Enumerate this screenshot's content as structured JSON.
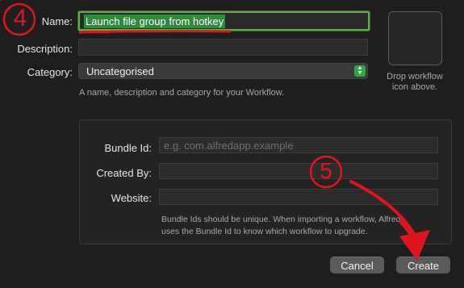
{
  "form": {
    "name_label": "Name:",
    "name_value": "Launch file group from hotkey",
    "description_label": "Description:",
    "description_value": "",
    "category_label": "Category:",
    "category_value": "Uncategorised",
    "form_hint": "A name, description and category for your Workflow.",
    "icon_drop_hint_line1": "Drop workflow",
    "icon_drop_hint_line2": "icon above."
  },
  "info": {
    "bundle_id_label": "Bundle Id:",
    "bundle_id_placeholder": "e.g. com.alfredapp.example",
    "created_by_label": "Created By:",
    "created_by_value": "",
    "website_label": "Website:",
    "website_value": "",
    "hint_line1": "Bundle Ids should be unique. When importing a workflow, Alfred",
    "hint_line2": "uses the Bundle Id to know which workflow to upgrade."
  },
  "buttons": {
    "cancel": "Cancel",
    "create": "Create"
  },
  "annotations": {
    "step_a": "4",
    "step_b": "5",
    "color": "#e0141e"
  },
  "icons": {
    "category_stepper": "up-down-chevrons-icon"
  }
}
